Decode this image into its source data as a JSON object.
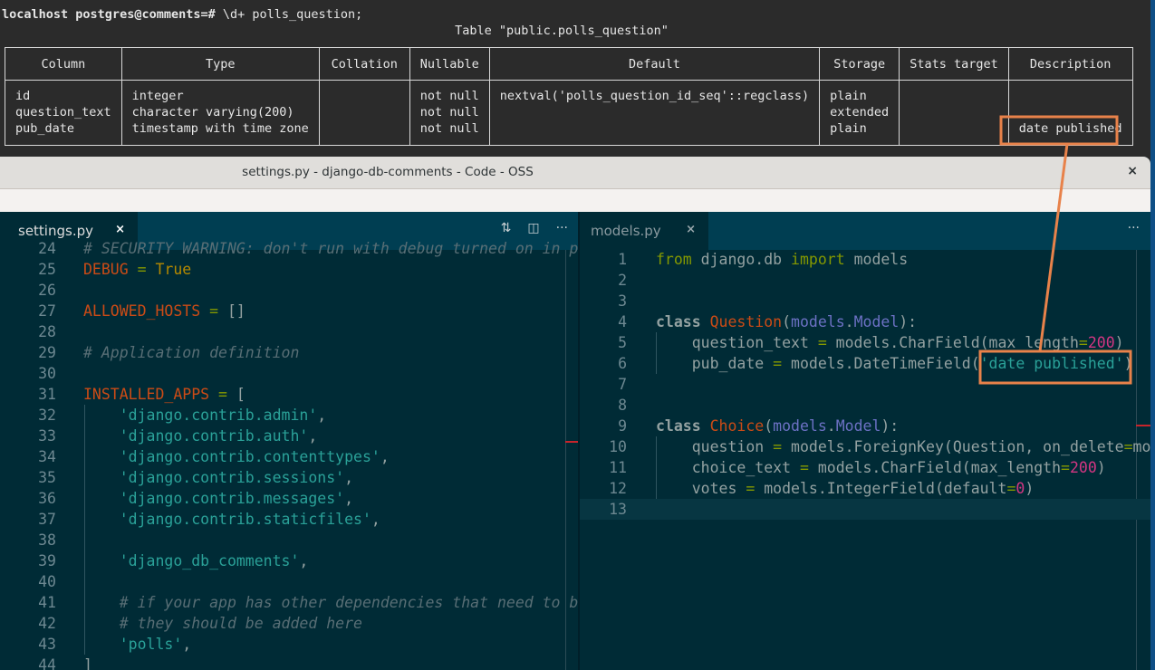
{
  "terminal": {
    "prompt_host": "localhost",
    "prompt_user_db": "postgres@comments",
    "prompt_suffix": "=#",
    "command": " \\d+ polls_question;",
    "table_title": "Table \"public.polls_question\"",
    "columns": [
      "Column",
      "Type",
      "Collation",
      "Nullable",
      "Default",
      "Storage",
      "Stats target",
      "Description"
    ],
    "rows": [
      {
        "column": "id",
        "type": "integer",
        "collation": "",
        "nullable": "not null",
        "default": "nextval('polls_question_id_seq'::regclass)",
        "storage": "plain",
        "stats_target": "",
        "description": ""
      },
      {
        "column": "question_text",
        "type": "character varying(200)",
        "collation": "",
        "nullable": "not null",
        "default": "",
        "storage": "extended",
        "stats_target": "",
        "description": ""
      },
      {
        "column": "pub_date",
        "type": "timestamp with time zone",
        "collation": "",
        "nullable": "not null",
        "default": "",
        "storage": "plain",
        "stats_target": "",
        "description": "date published"
      }
    ]
  },
  "window": {
    "title": "settings.py - django-db-comments - Code - OSS",
    "close_icon": "×"
  },
  "left_editor": {
    "tab_label": "settings.py",
    "tab_close": "×",
    "actions": {
      "compare_icon": "⇅",
      "split_icon": "◫",
      "more_icon": "···"
    },
    "lines": [
      {
        "n": "24",
        "tokens": [
          {
            "t": "# SECURITY WARNING: don't run with debug turned on in p",
            "c": "kw-cmt"
          }
        ]
      },
      {
        "n": "25",
        "tokens": [
          {
            "t": "DEBUG",
            "c": "kw-var"
          },
          {
            "t": " = ",
            "c": "kw-eq"
          },
          {
            "t": "True",
            "c": "kw-true"
          }
        ]
      },
      {
        "n": "26",
        "tokens": []
      },
      {
        "n": "27",
        "tokens": [
          {
            "t": "ALLOWED_HOSTS",
            "c": "kw-var"
          },
          {
            "t": " = ",
            "c": "kw-eq"
          },
          {
            "t": "[]",
            "c": "kw-plain"
          }
        ]
      },
      {
        "n": "28",
        "tokens": []
      },
      {
        "n": "29",
        "tokens": [
          {
            "t": "# Application definition",
            "c": "kw-cmt"
          }
        ]
      },
      {
        "n": "30",
        "tokens": []
      },
      {
        "n": "31",
        "tokens": [
          {
            "t": "INSTALLED_APPS",
            "c": "kw-var"
          },
          {
            "t": " = ",
            "c": "kw-eq"
          },
          {
            "t": "[",
            "c": "kw-plain"
          }
        ]
      },
      {
        "n": "32",
        "tokens": [
          {
            "t": "    'django.contrib.admin'",
            "c": "kw-str"
          },
          {
            "t": ",",
            "c": "kw-plain"
          }
        ]
      },
      {
        "n": "33",
        "tokens": [
          {
            "t": "    'django.contrib.auth'",
            "c": "kw-str"
          },
          {
            "t": ",",
            "c": "kw-plain"
          }
        ]
      },
      {
        "n": "34",
        "tokens": [
          {
            "t": "    'django.contrib.contenttypes'",
            "c": "kw-str"
          },
          {
            "t": ",",
            "c": "kw-plain"
          }
        ]
      },
      {
        "n": "35",
        "tokens": [
          {
            "t": "    'django.contrib.sessions'",
            "c": "kw-str"
          },
          {
            "t": ",",
            "c": "kw-plain"
          }
        ]
      },
      {
        "n": "36",
        "tokens": [
          {
            "t": "    'django.contrib.messages'",
            "c": "kw-str"
          },
          {
            "t": ",",
            "c": "kw-plain"
          }
        ]
      },
      {
        "n": "37",
        "tokens": [
          {
            "t": "    'django.contrib.staticfiles'",
            "c": "kw-str"
          },
          {
            "t": ",",
            "c": "kw-plain"
          }
        ]
      },
      {
        "n": "38",
        "tokens": []
      },
      {
        "n": "39",
        "tokens": [
          {
            "t": "    'django_db_comments'",
            "c": "kw-str"
          },
          {
            "t": ",",
            "c": "kw-plain"
          }
        ]
      },
      {
        "n": "40",
        "tokens": []
      },
      {
        "n": "41",
        "tokens": [
          {
            "t": "    # if your app has other dependencies that need to b",
            "c": "kw-cmt"
          }
        ]
      },
      {
        "n": "42",
        "tokens": [
          {
            "t": "    # they should be added here",
            "c": "kw-cmt"
          }
        ]
      },
      {
        "n": "43",
        "tokens": [
          {
            "t": "    'polls'",
            "c": "kw-str"
          },
          {
            "t": ",",
            "c": "kw-plain"
          }
        ]
      },
      {
        "n": "44",
        "tokens": [
          {
            "t": "]",
            "c": "kw-plain"
          }
        ]
      }
    ]
  },
  "right_editor": {
    "tab_label": "models.py",
    "tab_close": "×",
    "actions": {
      "more_icon": "···"
    },
    "lines": [
      {
        "n": "1",
        "tokens": [
          {
            "t": "from",
            "c": "kw-from"
          },
          {
            "t": " django.db ",
            "c": "kw-plain"
          },
          {
            "t": "import",
            "c": "kw-from"
          },
          {
            "t": " models",
            "c": "kw-plain"
          }
        ]
      },
      {
        "n": "2",
        "tokens": []
      },
      {
        "n": "3",
        "tokens": []
      },
      {
        "n": "4",
        "tokens": [
          {
            "t": "class",
            "c": "kw-class"
          },
          {
            "t": " ",
            "c": "kw-plain"
          },
          {
            "t": "Question",
            "c": "kw-cls"
          },
          {
            "t": "(",
            "c": "kw-plain"
          },
          {
            "t": "models",
            "c": "kw-base"
          },
          {
            "t": ".",
            "c": "kw-plain"
          },
          {
            "t": "Model",
            "c": "kw-base"
          },
          {
            "t": "):",
            "c": "kw-plain"
          }
        ]
      },
      {
        "n": "5",
        "tokens": [
          {
            "t": "    question_text ",
            "c": "kw-plain"
          },
          {
            "t": "=",
            "c": "kw-eq"
          },
          {
            "t": " models.CharField(max_length",
            "c": "kw-plain"
          },
          {
            "t": "=",
            "c": "kw-eq"
          },
          {
            "t": "200",
            "c": "kw-num"
          },
          {
            "t": ")",
            "c": "kw-plain"
          }
        ]
      },
      {
        "n": "6",
        "tokens": [
          {
            "t": "    pub_date ",
            "c": "kw-plain"
          },
          {
            "t": "=",
            "c": "kw-eq"
          },
          {
            "t": " models.DateTimeField(",
            "c": "kw-plain"
          },
          {
            "t": "'date published'",
            "c": "kw-str"
          },
          {
            "t": ")",
            "c": "kw-plain"
          }
        ]
      },
      {
        "n": "7",
        "tokens": []
      },
      {
        "n": "8",
        "tokens": []
      },
      {
        "n": "9",
        "tokens": [
          {
            "t": "class",
            "c": "kw-class"
          },
          {
            "t": " ",
            "c": "kw-plain"
          },
          {
            "t": "Choice",
            "c": "kw-cls"
          },
          {
            "t": "(",
            "c": "kw-plain"
          },
          {
            "t": "models",
            "c": "kw-base"
          },
          {
            "t": ".",
            "c": "kw-plain"
          },
          {
            "t": "Model",
            "c": "kw-base"
          },
          {
            "t": "):",
            "c": "kw-plain"
          }
        ]
      },
      {
        "n": "10",
        "tokens": [
          {
            "t": "    question ",
            "c": "kw-plain"
          },
          {
            "t": "=",
            "c": "kw-eq"
          },
          {
            "t": " models.ForeignKey(Question, on_delete",
            "c": "kw-plain"
          },
          {
            "t": "=",
            "c": "kw-eq"
          },
          {
            "t": "models.CASCADE)",
            "c": "kw-plain"
          }
        ]
      },
      {
        "n": "11",
        "tokens": [
          {
            "t": "    choice_text ",
            "c": "kw-plain"
          },
          {
            "t": "=",
            "c": "kw-eq"
          },
          {
            "t": " models.CharField(max_length",
            "c": "kw-plain"
          },
          {
            "t": "=",
            "c": "kw-eq"
          },
          {
            "t": "200",
            "c": "kw-num"
          },
          {
            "t": ")",
            "c": "kw-plain"
          }
        ]
      },
      {
        "n": "12",
        "tokens": [
          {
            "t": "    votes ",
            "c": "kw-plain"
          },
          {
            "t": "=",
            "c": "kw-eq"
          },
          {
            "t": " models.IntegerField(default",
            "c": "kw-plain"
          },
          {
            "t": "=",
            "c": "kw-eq"
          },
          {
            "t": "0",
            "c": "kw-num"
          },
          {
            "t": ")",
            "c": "kw-plain"
          }
        ]
      },
      {
        "n": "13",
        "tokens": []
      }
    ],
    "cursor_line": "13"
  },
  "annotation": {
    "color": "#e8824a",
    "label": "date published"
  }
}
